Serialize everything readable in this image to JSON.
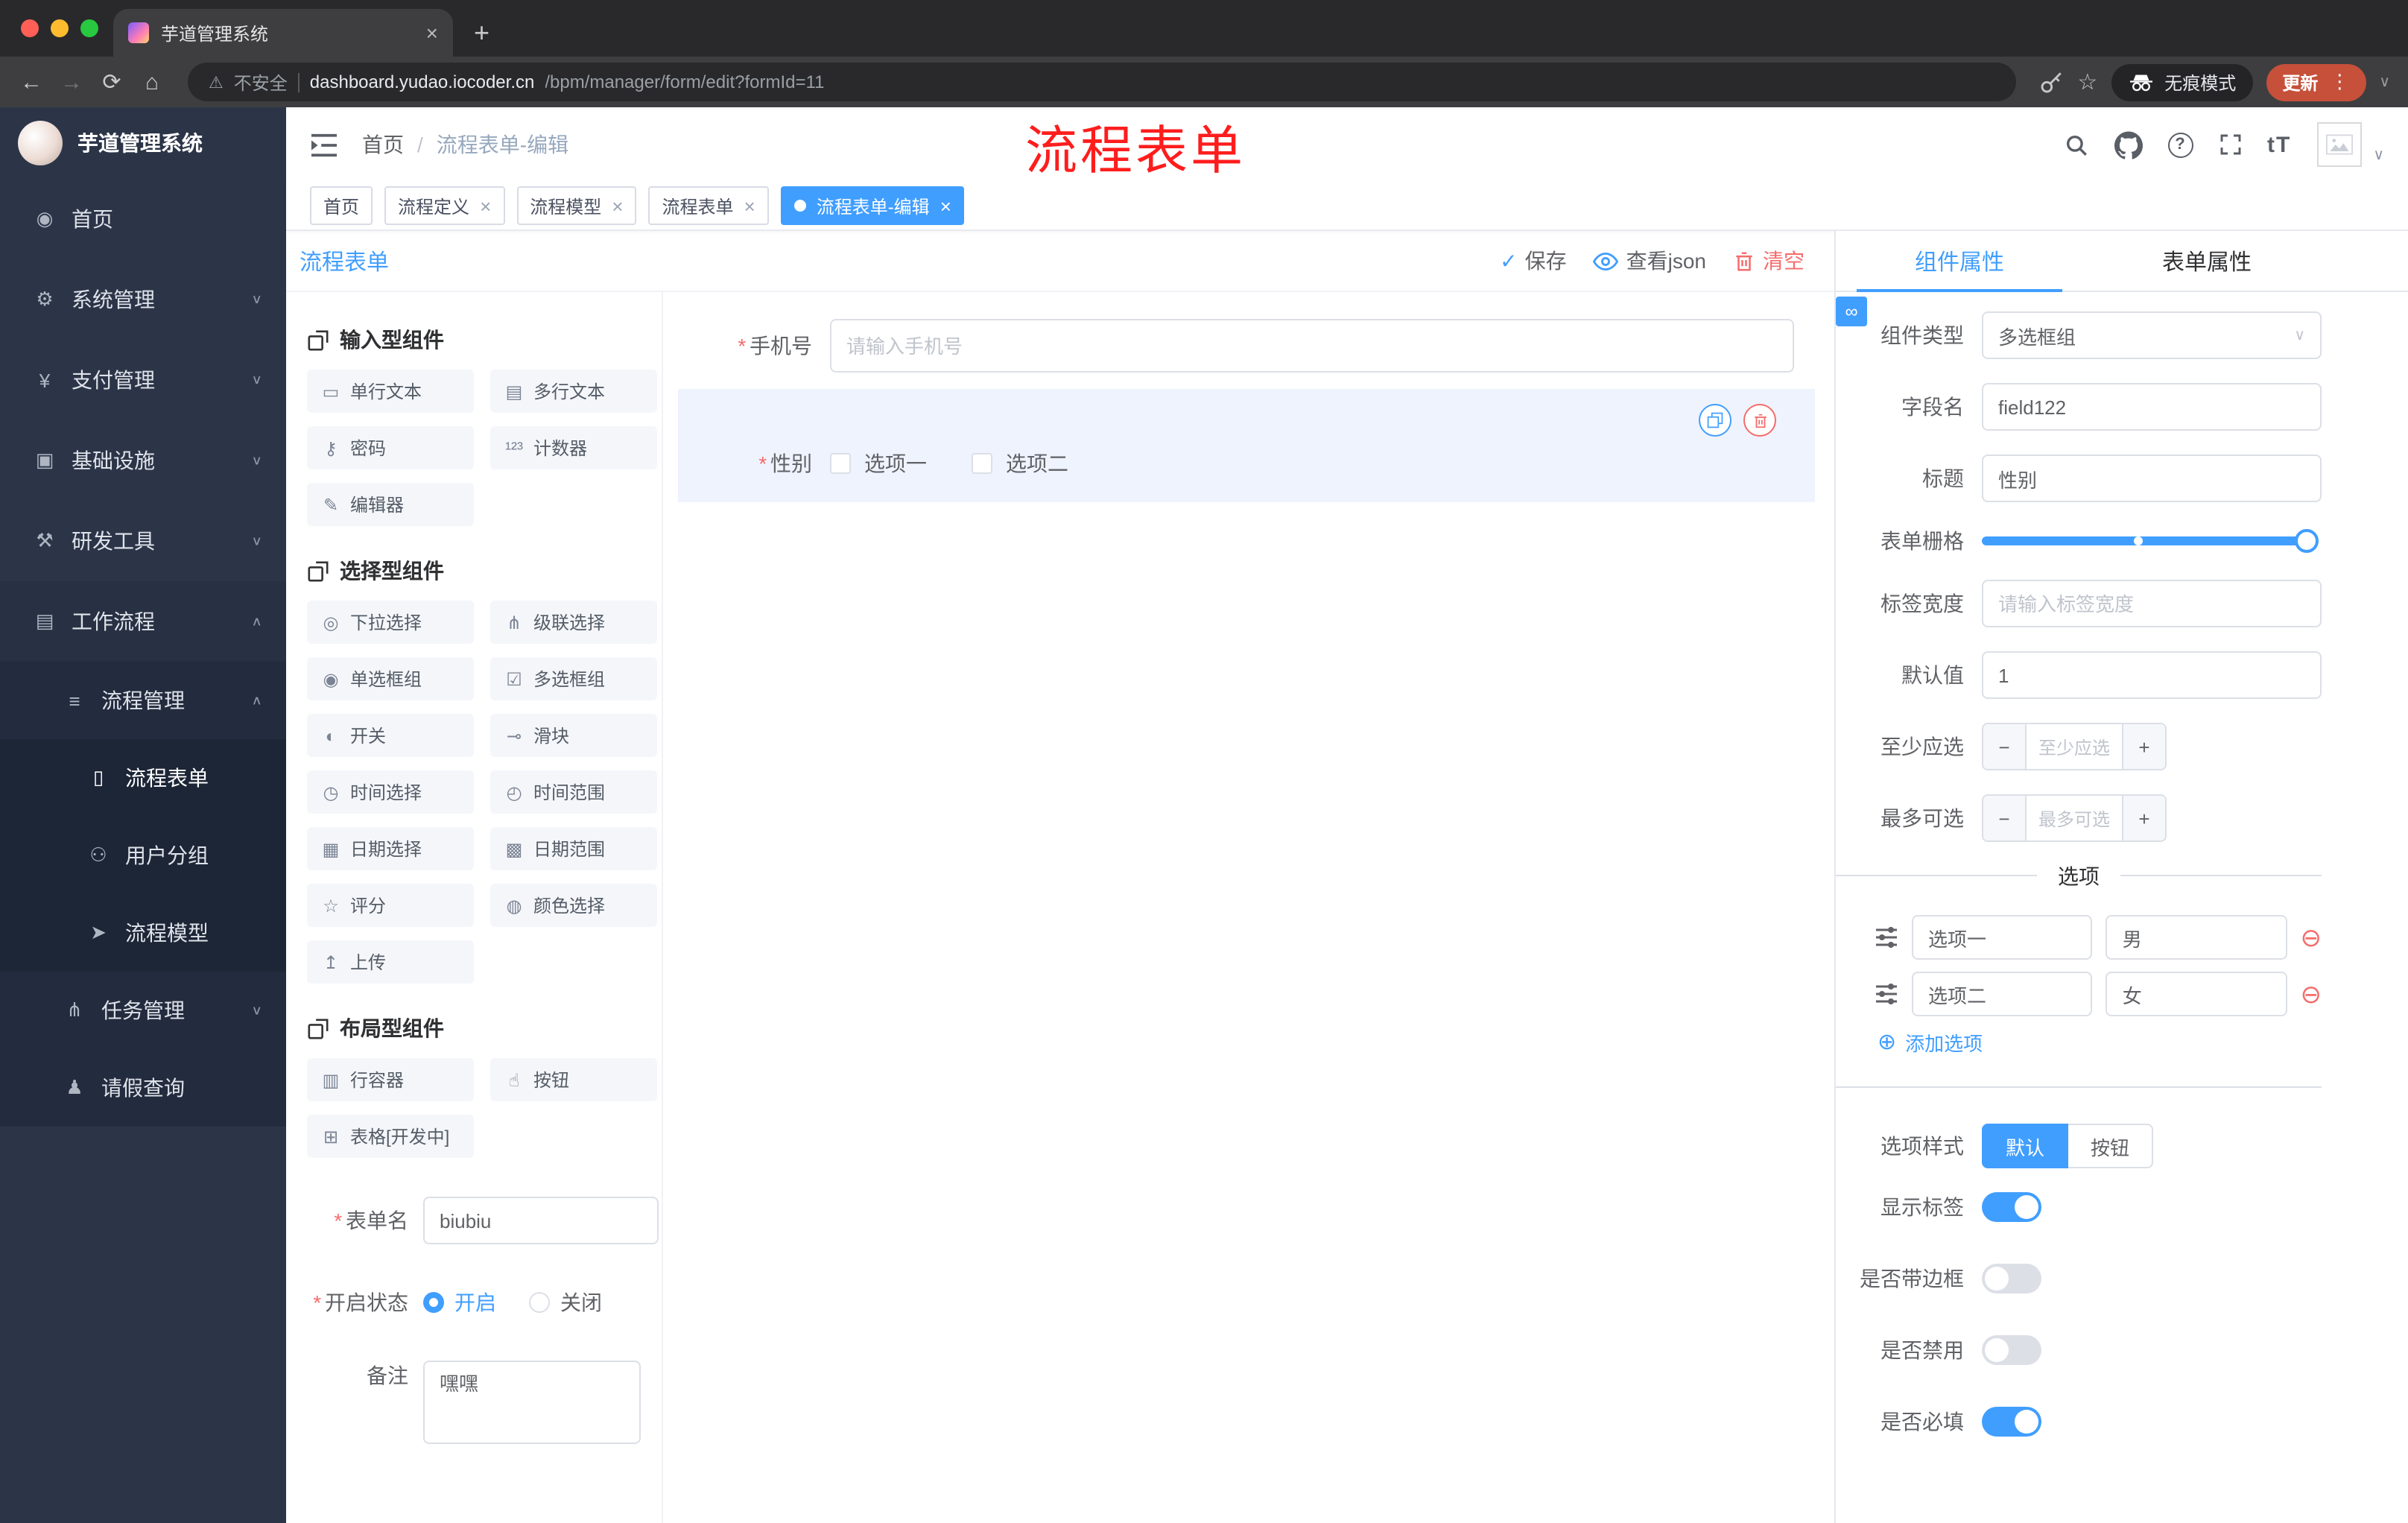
{
  "colors": {
    "accent": "#409eff",
    "danger": "#f56c6c",
    "annotation_red": "#fe1d1d",
    "update_badge": "#c6503a",
    "sidebar_bg": "#2c3548",
    "selected_widget_bg": "#eff3fd"
  },
  "icons": {
    "back": "←",
    "forward": "→",
    "reload": "⟳",
    "home": "⌂",
    "warning": "⚠",
    "star": "☆",
    "dots": "⋮",
    "chevron_down": "∨",
    "chevron_up": "∧",
    "close": "×",
    "new_tab": "+",
    "breadcrumb_sep": "/",
    "question": "?",
    "font_size": "tT",
    "select_caret": "∨",
    "minus": "−",
    "plus": "+",
    "remove_option": "⊖",
    "add_option": "⊕",
    "link": "∞",
    "save_check": "✓"
  },
  "browser": {
    "tab_title": "芋道管理系统",
    "security_label": "不安全",
    "url_domain": "dashboard.yudao.iocoder.cn",
    "url_path": "/bpm/manager/form/edit?formId=11",
    "incognito_label": "无痕模式",
    "update_label": "更新"
  },
  "sidebar": {
    "logo_title": "芋道管理系统",
    "items": [
      {
        "icon": "◉",
        "label": "首页"
      },
      {
        "icon": "⚙",
        "label": "系统管理"
      },
      {
        "icon": "¥",
        "label": "支付管理"
      },
      {
        "icon": "▣",
        "label": "基础设施"
      },
      {
        "icon": "⚒",
        "label": "研发工具"
      },
      {
        "icon": "▤",
        "label": "工作流程"
      },
      {
        "icon": "≡",
        "label": "流程管理"
      },
      {
        "icon": "▯",
        "label": "流程表单"
      },
      {
        "icon": "⚇",
        "label": "用户分组"
      },
      {
        "icon": "➤",
        "label": "流程模型"
      },
      {
        "icon": "⋔",
        "label": "任务管理"
      },
      {
        "icon": "♟",
        "label": "请假查询"
      }
    ]
  },
  "header": {
    "breadcrumb_home": "首页",
    "breadcrumb_current": "流程表单-编辑",
    "annotation": "流程表单"
  },
  "tags": [
    {
      "label": "首页",
      "closable": false,
      "active": false
    },
    {
      "label": "流程定义",
      "closable": true,
      "active": false
    },
    {
      "label": "流程模型",
      "closable": true,
      "active": false
    },
    {
      "label": "流程表单",
      "closable": true,
      "active": false
    },
    {
      "label": "流程表单-编辑",
      "closable": true,
      "active": true
    }
  ],
  "designer": {
    "panel_title": "流程表单",
    "save_label": "保存",
    "view_json_label": "查看json",
    "clear_label": "清空",
    "required_mark": "*",
    "palette": {
      "groups": [
        {
          "title": "输入型组件",
          "items": [
            {
              "icon": "▭",
              "label": "单行文本"
            },
            {
              "icon": "▤",
              "label": "多行文本"
            },
            {
              "icon": "⚷",
              "label": "密码"
            },
            {
              "icon": "¹²³",
              "label": "计数器"
            },
            {
              "icon": "✎",
              "label": "编辑器"
            }
          ]
        },
        {
          "title": "选择型组件",
          "items": [
            {
              "icon": "◎",
              "label": "下拉选择"
            },
            {
              "icon": "⋔",
              "label": "级联选择"
            },
            {
              "icon": "◉",
              "label": "单选框组"
            },
            {
              "icon": "☑",
              "label": "多选框组"
            },
            {
              "icon": "◐",
              "label": "开关"
            },
            {
              "icon": "⊸",
              "label": "滑块"
            },
            {
              "icon": "◷",
              "label": "时间选择"
            },
            {
              "icon": "◴",
              "label": "时间范围"
            },
            {
              "icon": "▦",
              "label": "日期选择"
            },
            {
              "icon": "▩",
              "label": "日期范围"
            },
            {
              "icon": "☆",
              "label": "评分"
            },
            {
              "icon": "◍",
              "label": "颜色选择"
            },
            {
              "icon": "↥",
              "label": "上传"
            }
          ]
        },
        {
          "title": "布局型组件",
          "items": [
            {
              "icon": "▥",
              "label": "行容器"
            },
            {
              "icon": "☝",
              "label": "按钮"
            },
            {
              "icon": "⊞",
              "label": "表格[开发中]"
            }
          ]
        }
      ]
    },
    "meta": {
      "name_label": "表单名",
      "name_value": "biubiu",
      "status_label": "开启状态",
      "status_on": "开启",
      "status_off": "关闭",
      "remark_label": "备注",
      "remark_value": "嘿嘿"
    },
    "canvas": {
      "phone_label": "手机号",
      "phone_placeholder": "请输入手机号",
      "gender_label": "性别",
      "option1": "选项一",
      "option2": "选项二"
    }
  },
  "props": {
    "tab_component": "组件属性",
    "tab_form": "表单属性",
    "component_type_label": "组件类型",
    "component_type_value": "多选框组",
    "field_name_label": "字段名",
    "field_name_value": "field122",
    "title_label": "标题",
    "title_value": "性别",
    "grid_label": "表单栅格",
    "label_width_label": "标签宽度",
    "label_width_placeholder": "请输入标签宽度",
    "default_label": "默认值",
    "default_value": "1",
    "min_label": "至少应选",
    "min_placeholder": "至少应选",
    "max_label": "最多可选",
    "max_placeholder": "最多可选",
    "options_title": "选项",
    "options": [
      {
        "label": "选项一",
        "value": "男"
      },
      {
        "label": "选项二",
        "value": "女"
      }
    ],
    "add_option_label": "添加选项",
    "style_label": "选项样式",
    "style_default": "默认",
    "style_button": "按钮",
    "switch_show_label": "显示标签",
    "switch_border": "是否带边框",
    "switch_disabled": "是否禁用",
    "switch_required": "是否必填"
  }
}
